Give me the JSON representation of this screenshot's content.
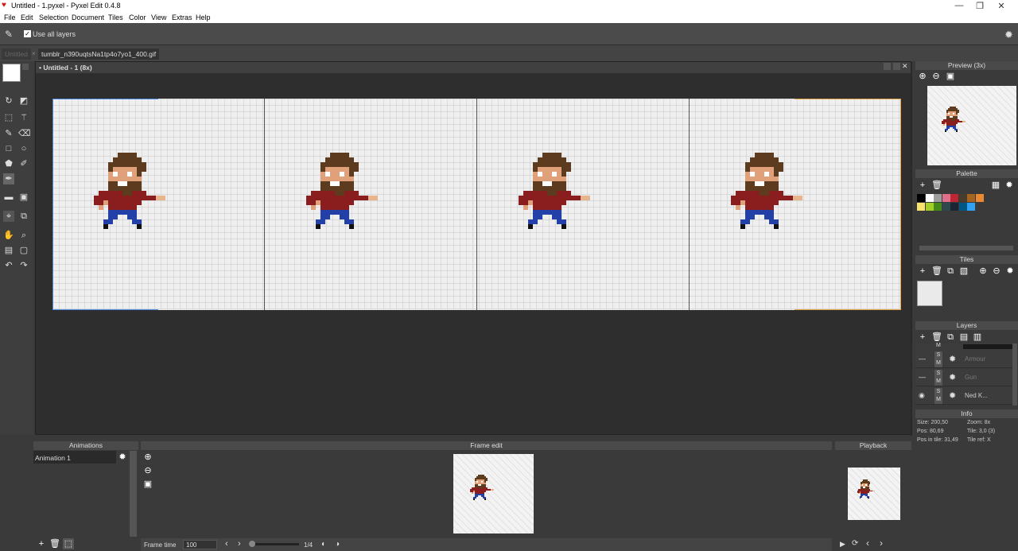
{
  "window": {
    "title": "Untitled - 1.pyxel - Pyxel Edit 0.4.8"
  },
  "menu": [
    "File",
    "Edit",
    "Selection",
    "Document",
    "Tiles",
    "Color",
    "View",
    "Extras",
    "Help"
  ],
  "tool_options": {
    "use_all_layers_label": "Use all layers"
  },
  "tabs": {
    "inactive": "Untitled",
    "active": "tumblr_n390uqtsNa1tp4o7yo1_400.gif"
  },
  "document": {
    "title": "• Untitled - 1   (8x)"
  },
  "panels": {
    "preview": "Preview (3x)",
    "palette": "Palette",
    "tiles": "Tiles",
    "layers": "Layers",
    "info": "Info",
    "animations": "Animations",
    "frame_edit": "Frame edit",
    "playback": "Playback"
  },
  "palette_colors": [
    "#000000",
    "#ffffff",
    "#9d9d9d",
    "#e06f8b",
    "#be2633",
    "#493c2b",
    "#a46422",
    "#eb8931",
    "#f7e26b",
    "#a3ce27",
    "#44891a",
    "#2f484e",
    "#1b2632",
    "#005784",
    "#31a2f2"
  ],
  "layers": [
    {
      "name": "Armour",
      "s": "S",
      "m": "M"
    },
    {
      "name": "Gun",
      "s": "S",
      "m": "M"
    },
    {
      "name": "Ned K...",
      "s": "S",
      "m": "M"
    }
  ],
  "layer_top_m": "M",
  "info": {
    "size": "Size: 200,50",
    "zoom": "Zoom: 8x",
    "pos": "Pos: 80,69",
    "tile": "Tile: 3,0 (3)",
    "pos_in_tile": "Pos in tile: 31,49",
    "tile_ref": "Tile ref: X"
  },
  "animations": [
    {
      "name": "Animation 1"
    }
  ],
  "frame": {
    "time_label": "Frame time",
    "time_value": "100",
    "counter": "1/4"
  }
}
